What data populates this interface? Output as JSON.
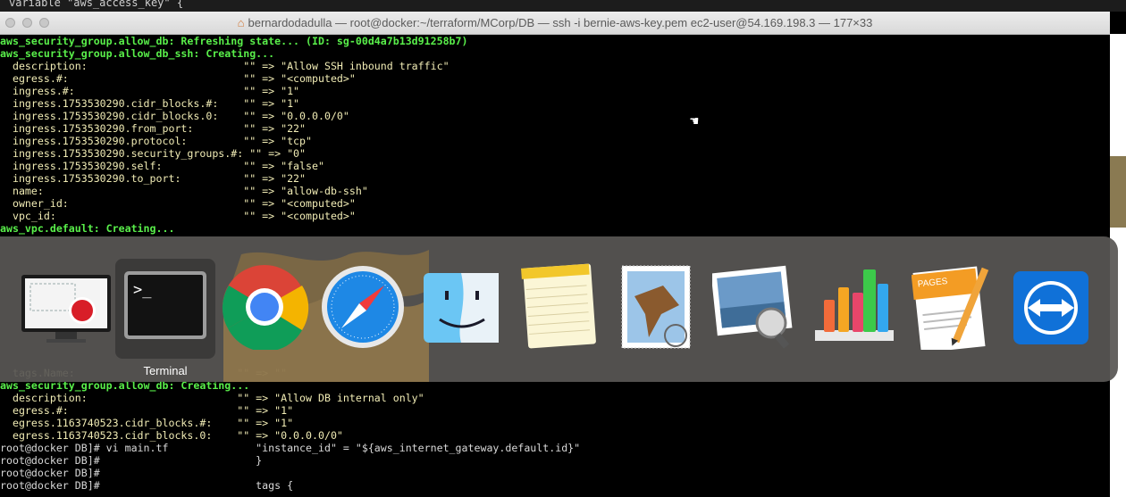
{
  "behind_window_text": "variable \"aws_access_key\" {",
  "window": {
    "title": "bernardodadulla — root@docker:~/terraform/MCorp/DB — ssh -i bernie-aws-key.pem ec2-user@54.169.198.3 — 177×33"
  },
  "terminal_top": [
    {
      "text": "aws_security_group.allow_db: Refreshing state... (ID: sg-00d4a7b13d91258b7)",
      "style": "g"
    },
    {
      "text": "aws_security_group.allow_db_ssh: Creating...",
      "style": "g"
    },
    {
      "text": "  description:                         \"\" => \"Allow SSH inbound traffic\"",
      "style": "y"
    },
    {
      "text": "  egress.#:                            \"\" => \"<computed>\"",
      "style": "y"
    },
    {
      "text": "  ingress.#:                           \"\" => \"1\"",
      "style": "y"
    },
    {
      "text": "  ingress.1753530290.cidr_blocks.#:    \"\" => \"1\"",
      "style": "y"
    },
    {
      "text": "  ingress.1753530290.cidr_blocks.0:    \"\" => \"0.0.0.0/0\"",
      "style": "y"
    },
    {
      "text": "  ingress.1753530290.from_port:        \"\" => \"22\"",
      "style": "y"
    },
    {
      "text": "  ingress.1753530290.protocol:         \"\" => \"tcp\"",
      "style": "y"
    },
    {
      "text": "  ingress.1753530290.security_groups.#: \"\" => \"0\"",
      "style": "y"
    },
    {
      "text": "  ingress.1753530290.self:             \"\" => \"false\"",
      "style": "y"
    },
    {
      "text": "  ingress.1753530290.to_port:          \"\" => \"22\"",
      "style": "y"
    },
    {
      "text": "  name:                                \"\" => \"allow-db-ssh\"",
      "style": "y"
    },
    {
      "text": "  owner_id:                            \"\" => \"<computed>\"",
      "style": "y"
    },
    {
      "text": "  vpc_id:                              \"\" => \"<computed>\"",
      "style": "y"
    },
    {
      "text": "aws_vpc.default: Creating...",
      "style": "g"
    }
  ],
  "terminal_bottom": [
    {
      "text": "  tags.Name:                          \"\" => \"\"",
      "style": "y"
    },
    {
      "text": "aws_security_group.allow_db: Creating...",
      "style": "g"
    },
    {
      "text": "  description:                        \"\" => \"Allow DB internal only\"",
      "style": "y"
    },
    {
      "text": "  egress.#:                           \"\" => \"1\"",
      "style": "y"
    },
    {
      "text": "  egress.1163740523.cidr_blocks.#:    \"\" => \"1\"",
      "style": "y"
    },
    {
      "text": "  egress.1163740523.cidr_blocks.0:    \"\" => \"0.0.0.0/0\"",
      "style": "y"
    },
    {
      "text": "root@docker DB]# vi main.tf              \"instance_id\" = \"${aws_internet_gateway.default.id}\"",
      "style": "w"
    },
    {
      "text": "root@docker DB]#                         }",
      "style": "w"
    },
    {
      "text": "root@docker DB]#",
      "style": "w"
    },
    {
      "text": "root@docker DB]#                         tags {",
      "style": "w"
    }
  ],
  "dock": {
    "active_label": "Terminal",
    "apps": [
      {
        "name": "Screen Recorder",
        "icon": "screen-recorder-icon"
      },
      {
        "name": "Terminal",
        "icon": "terminal-icon",
        "prompt": ">_"
      },
      {
        "name": "Google Chrome",
        "icon": "chrome-icon"
      },
      {
        "name": "Safari",
        "icon": "safari-icon"
      },
      {
        "name": "Finder",
        "icon": "finder-icon"
      },
      {
        "name": "Notes",
        "icon": "notes-icon"
      },
      {
        "name": "Mail",
        "icon": "mail-icon"
      },
      {
        "name": "Preview",
        "icon": "preview-icon"
      },
      {
        "name": "Numbers",
        "icon": "numbers-icon"
      },
      {
        "name": "Pages",
        "icon": "pages-icon",
        "badge": "PAGES"
      },
      {
        "name": "TeamViewer",
        "icon": "teamviewer-icon"
      }
    ]
  }
}
